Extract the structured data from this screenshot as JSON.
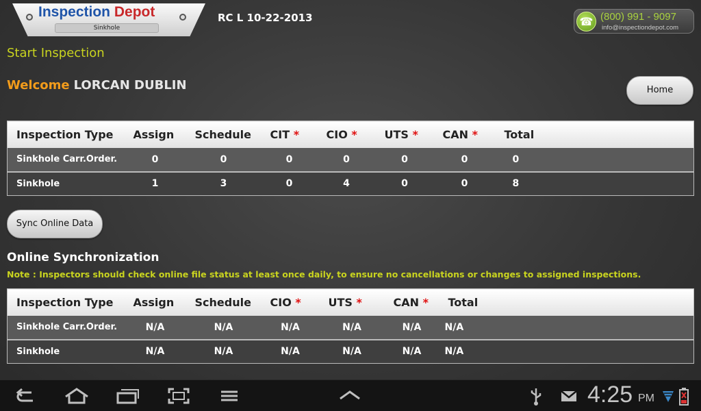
{
  "header": {
    "logo_part1": "Inspection",
    "logo_part2": "Depot",
    "logo_sub": "Sinkhole",
    "version": "RC L 10-22-2013",
    "phone": "(800) 991 - 9097",
    "email": "info@inspectiondepot.com"
  },
  "page": {
    "title": "Start Inspection",
    "welcome_label": "Welcome",
    "user_name": "LORCAN DUBLIN",
    "home_button": "Home",
    "sync_button": "Sync Online Data"
  },
  "table1": {
    "headers": [
      "Inspection Type",
      "Assign",
      "Schedule",
      "CIT",
      "CIO",
      "UTS",
      "CAN",
      "Total"
    ],
    "star": "*",
    "rows": [
      [
        "Sinkhole Carr.Order.",
        "0",
        "0",
        "0",
        "0",
        "0",
        "0",
        "0"
      ],
      [
        "Sinkhole",
        "1",
        "3",
        "0",
        "4",
        "0",
        "0",
        "8"
      ]
    ]
  },
  "sync": {
    "title": "Online Synchronization",
    "note": "Note : Inspectors should check online file status at least once daily, to ensure no cancellations or changes to assigned inspections."
  },
  "table2": {
    "headers": [
      "Inspection Type",
      "Assign",
      "Schedule",
      "CIO",
      "UTS",
      "CAN",
      "Total"
    ],
    "star": "*",
    "rows": [
      [
        "Sinkhole Carr.Order.",
        "N/A",
        "N/A",
        "N/A",
        "N/A",
        "N/A",
        "N/A"
      ],
      [
        "Sinkhole",
        "N/A",
        "N/A",
        "N/A",
        "N/A",
        "N/A",
        "N/A"
      ]
    ]
  },
  "statusbar": {
    "time": "4:25",
    "ampm": "PM",
    "icons": [
      "back-icon",
      "home-icon",
      "recent-apps-icon",
      "screenshot-icon",
      "menu-icon",
      "up-chevron-icon",
      "usb-icon",
      "gmail-icon",
      "wifi-icon",
      "battery-icon"
    ]
  }
}
